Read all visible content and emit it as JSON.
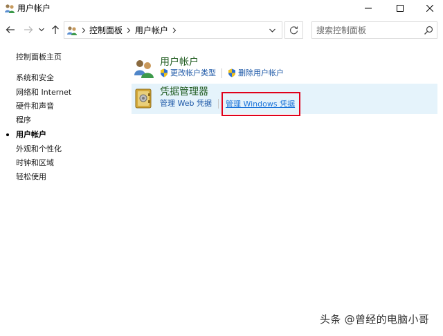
{
  "window": {
    "title": "用户帐户",
    "controls": {
      "minimize": "minimize-icon",
      "maximize": "maximize-icon",
      "close": "close-icon"
    }
  },
  "nav": {
    "back": "back-arrow-icon",
    "forward": "forward-arrow-icon",
    "recent": "chevron-down-icon",
    "up": "up-arrow-icon"
  },
  "address": {
    "crumbs": [
      "控制面板",
      "用户帐户"
    ]
  },
  "search": {
    "placeholder": "搜索控制面板"
  },
  "sidebar": {
    "items": [
      {
        "label": "控制面板主页",
        "active": false
      },
      {
        "label": "系统和安全",
        "active": false
      },
      {
        "label": "网络和 Internet",
        "active": false
      },
      {
        "label": "硬件和声音",
        "active": false
      },
      {
        "label": "程序",
        "active": false
      },
      {
        "label": "用户帐户",
        "active": true
      },
      {
        "label": "外观和个性化",
        "active": false
      },
      {
        "label": "时钟和区域",
        "active": false
      },
      {
        "label": "轻松使用",
        "active": false
      }
    ]
  },
  "main": {
    "user_accounts": {
      "title": "用户帐户",
      "links": [
        "更改帐户类型",
        "删除用户帐户"
      ]
    },
    "credential_manager": {
      "title": "凭据管理器",
      "links": [
        "管理 Web 凭据",
        "管理 Windows 凭据"
      ]
    }
  },
  "watermark": "头条 @曾经的电脑小哥",
  "colors": {
    "link": "#1a56a6",
    "title_green": "#1e5a1e",
    "highlight_red": "#e0001a",
    "selected_bg": "#e5f3fb"
  }
}
